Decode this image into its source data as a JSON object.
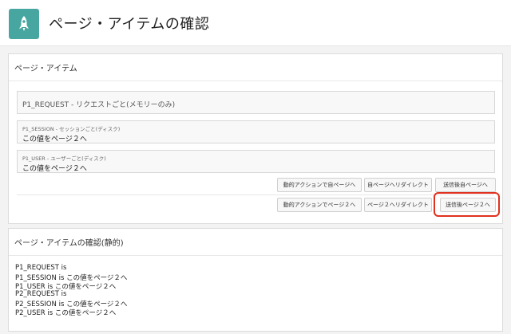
{
  "header": {
    "title": "ページ・アイテムの確認",
    "icon": "rocket-icon",
    "accent": "#48a6a1"
  },
  "page_items_region": {
    "title": "ページ・アイテム",
    "fields": [
      {
        "label": "P1_REQUEST - リクエストごと(メモリーのみ)",
        "value": ""
      },
      {
        "label": "P1_SESSION - セッションごと(ディスク)",
        "value": "この値をページ２へ"
      },
      {
        "label": "P1_USER - ユーザーごと(ディスク)",
        "value": "この値をページ２へ"
      }
    ],
    "buttons_row1": [
      "動的アクションで自ページへ",
      "自ページへリダイレクト",
      "送信後自ページへ"
    ],
    "buttons_row2": [
      "動的アクションでページ２へ",
      "ページ２へリダイレクト",
      "送信後ページ２へ"
    ],
    "highlight_color": "#e0301e"
  },
  "confirm_region": {
    "title": "ページ・アイテムの確認(静的)",
    "lines": [
      "P1_REQUEST is",
      "P1_SESSION is この値をページ２へ",
      "P1_USER is この値をページ２へ",
      "P2_REQUEST is",
      "P2_SESSION is この値をページ２へ",
      "P2_USER is この値をページ２へ"
    ]
  }
}
